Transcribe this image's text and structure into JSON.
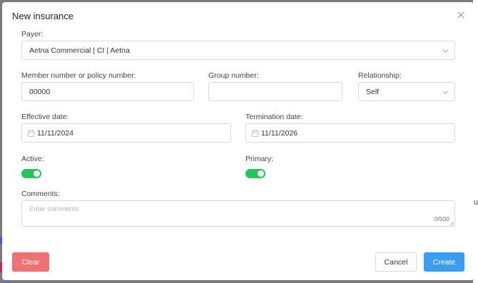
{
  "modal": {
    "title": "New insurance"
  },
  "payer": {
    "label": "Payer:",
    "value": "Aetna Commercial | CI | Aetna"
  },
  "member": {
    "label": "Member number or policy number:",
    "value": "00000"
  },
  "group": {
    "label": "Group number:",
    "value": ""
  },
  "relationship": {
    "label": "Relationship:",
    "value": "Self"
  },
  "effective": {
    "label": "Effective date:",
    "value": "11/11/2024"
  },
  "termination": {
    "label": "Termination date:",
    "value": "11/11/2026"
  },
  "active": {
    "label": "Active:",
    "on": true
  },
  "primary": {
    "label": "Primary:",
    "on": true
  },
  "comments": {
    "label": "Comments:",
    "placeholder": "Enter comments",
    "counter": "0/500"
  },
  "buttons": {
    "clear": "Clear",
    "cancel": "Cancel",
    "create": "Create"
  },
  "background": {
    "edge_char": "u"
  },
  "colors": {
    "toggle_on": "#22c55e",
    "clear": "#f07171",
    "create": "#3b9cf0"
  }
}
